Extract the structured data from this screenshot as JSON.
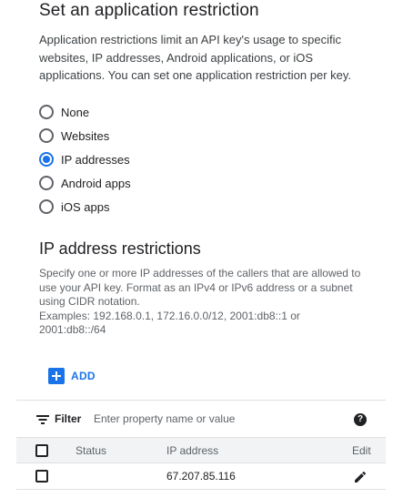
{
  "app_restriction": {
    "title": "Set an application restriction",
    "description": "Application restrictions limit an API key's usage to specific websites, IP addresses, Android applications, or iOS applications. You can set one application restriction per key.",
    "options": [
      {
        "label": "None",
        "checked": false
      },
      {
        "label": "Websites",
        "checked": false
      },
      {
        "label": "IP addresses",
        "checked": true
      },
      {
        "label": "Android apps",
        "checked": false
      },
      {
        "label": "iOS apps",
        "checked": false
      }
    ]
  },
  "ip_restrictions": {
    "title": "IP address restrictions",
    "description": "Specify one or more IP addresses of the callers that are allowed to use your API key. Format as an IPv4 or IPv6 address or a subnet using CIDR notation.",
    "examples": "Examples: 192.168.0.1, 172.16.0.0/12, 2001:db8::1 or 2001:db8::/64",
    "add_label": "ADD"
  },
  "table": {
    "filter_label": "Filter",
    "filter_placeholder": "Enter property name or value",
    "filter_value": "",
    "columns": {
      "status": "Status",
      "ip": "IP address",
      "edit": "Edit"
    },
    "rows": [
      {
        "status": "",
        "ip": "67.207.85.116"
      }
    ]
  },
  "icons": {
    "add": "add-box-icon",
    "filter": "filter-list-icon",
    "help": "help-icon",
    "edit": "pencil-icon"
  },
  "colors": {
    "accent": "#1a73e8",
    "text": "#202124",
    "muted": "#5f6368",
    "header_bg": "#f1f3f4"
  }
}
